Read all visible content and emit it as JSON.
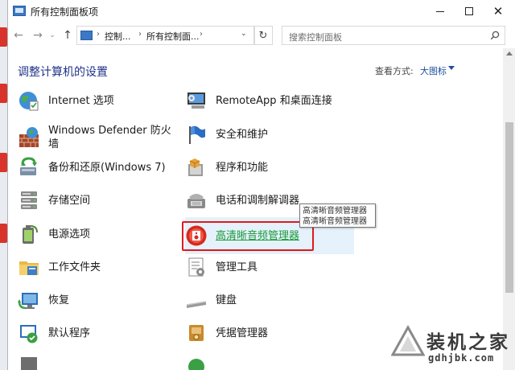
{
  "window": {
    "title": "所有控制面板项",
    "minimize_icon": "minimize-icon",
    "maximize_icon": "maximize-icon",
    "close_icon": "close-icon"
  },
  "address_bar": {
    "back_icon": "arrow-left-icon",
    "forward_icon": "arrow-right-icon",
    "up_icon": "arrow-up-icon",
    "crumbs": [
      "控制...",
      "所有控制面...",
      ""
    ],
    "refresh_icon": "refresh-icon",
    "search_placeholder": "搜索控制面板"
  },
  "content": {
    "heading": "调整计算机的设置",
    "view_by_label": "查看方式:",
    "view_by_value": "大图标"
  },
  "items_left": [
    {
      "label": "Internet 选项",
      "icon": "internet-options-icon"
    },
    {
      "label": "Windows Defender 防火墙",
      "icon": "firewall-icon"
    },
    {
      "label": "备份和还原(Windows 7)",
      "icon": "backup-restore-icon"
    },
    {
      "label": "存储空间",
      "icon": "storage-spaces-icon"
    },
    {
      "label": "电源选项",
      "icon": "power-options-icon"
    },
    {
      "label": "工作文件夹",
      "icon": "work-folders-icon"
    },
    {
      "label": "恢复",
      "icon": "recovery-icon"
    },
    {
      "label": "默认程序",
      "icon": "default-programs-icon"
    }
  ],
  "items_right": [
    {
      "label": "RemoteApp 和桌面连接",
      "icon": "remoteapp-icon"
    },
    {
      "label": "安全和维护",
      "icon": "security-maintenance-icon"
    },
    {
      "label": "程序和功能",
      "icon": "programs-features-icon"
    },
    {
      "label": "电话和调制解调器",
      "icon": "phone-modem-icon"
    },
    {
      "label": "高清晰音频管理器",
      "icon": "hd-audio-manager-icon"
    },
    {
      "label": "管理工具",
      "icon": "admin-tools-icon"
    },
    {
      "label": "键盘",
      "icon": "keyboard-icon"
    },
    {
      "label": "凭据管理器",
      "icon": "credential-manager-icon"
    }
  ],
  "tooltip": {
    "line1": "高清晰音频管理器",
    "line2": "高清晰音频管理器"
  },
  "watermark": {
    "title": "装机之家",
    "url": "gdhjbk.com"
  },
  "colors": {
    "link_blue": "#1e3287",
    "hover_green": "#1a9a3a",
    "highlight_red": "#e0191e"
  }
}
